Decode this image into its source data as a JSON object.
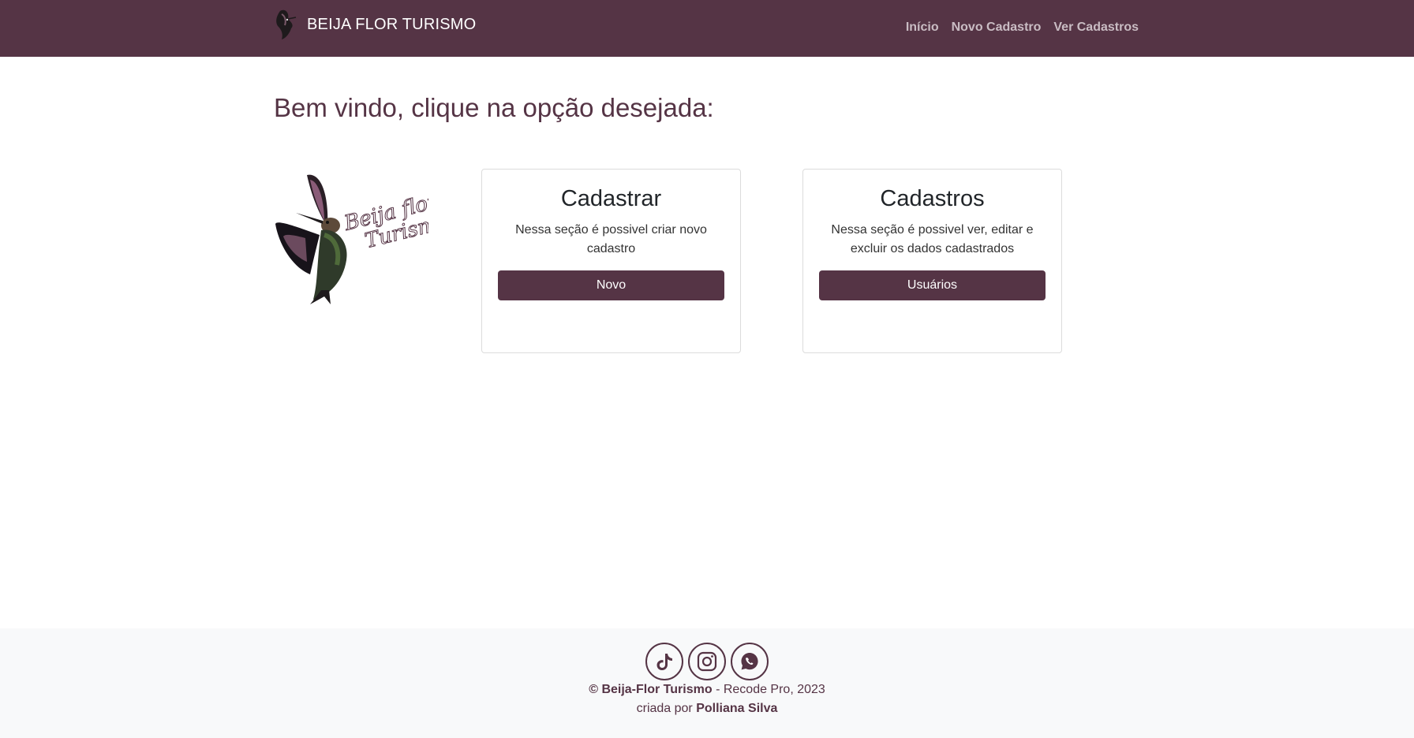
{
  "navbar": {
    "brand": "BEIJA FLOR TURISMO",
    "links": [
      "Início",
      "Novo Cadastro",
      "Ver Cadastros"
    ]
  },
  "main": {
    "heading": "Bem vindo, clique na opção desejada:",
    "cards": [
      {
        "title": "Cadastrar",
        "text": "Nessa seção é possivel criar novo cadastro",
        "button": "Novo"
      },
      {
        "title": "Cadastros",
        "text": "Nessa seção é possivel ver, editar e excluir os dados cadastrados",
        "button": "Usuários"
      }
    ]
  },
  "hero_logo_text": "Beija flor Turismo",
  "footer": {
    "social_icons": [
      "tiktok-icon",
      "instagram-icon",
      "whatsapp-icon"
    ],
    "copyright_symbol": "©",
    "company": "Beija-Flor Turismo",
    "credit_rest": "- Recode Pro, 2023",
    "created_by_prefix": "criada por",
    "author": "Polliana Silva"
  },
  "colors": {
    "primary": "#553445",
    "nav_link": "#c9bcc3",
    "footer_bg": "#f8f9fa"
  }
}
